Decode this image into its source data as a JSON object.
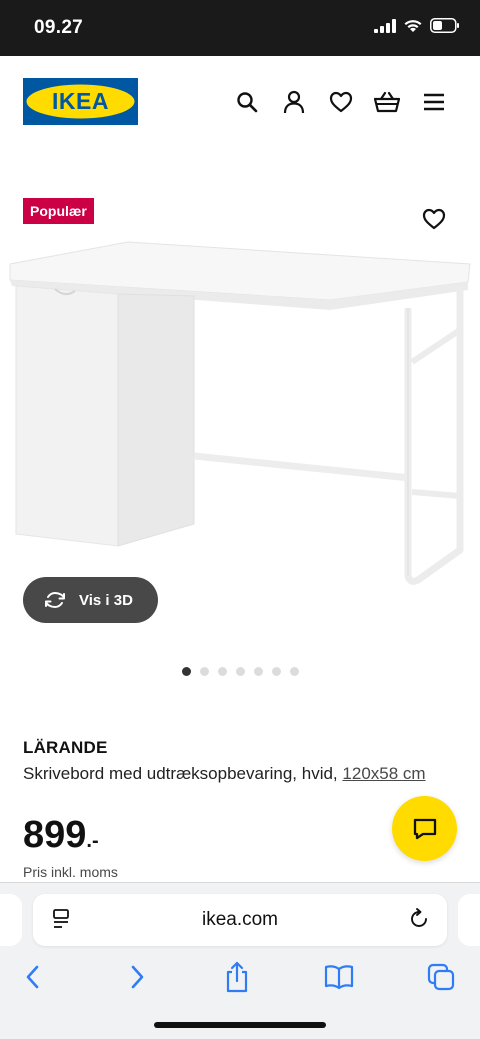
{
  "status_bar": {
    "time": "09.27"
  },
  "header": {
    "logo_text": "IKEA",
    "icons": [
      "search-icon",
      "user-icon",
      "heart-icon",
      "basket-icon",
      "menu-icon"
    ]
  },
  "gallery": {
    "badge": "Populær",
    "view_3d_label": "Vis i 3D",
    "image_count": 7,
    "active_image": 1
  },
  "product": {
    "name": "LÄRANDE",
    "description": "Skrivebord med udtræksopbevaring, hvid,",
    "size": "120x58 cm",
    "price": "899",
    "price_suffix": ".-",
    "vat_note": "Pris inkl. moms"
  },
  "browser": {
    "url": "ikea.com"
  },
  "colors": {
    "ikea_blue": "#0058a3",
    "ikea_yellow": "#ffdb00",
    "badge_red": "#cc0044",
    "view3d_bg": "#484848"
  }
}
